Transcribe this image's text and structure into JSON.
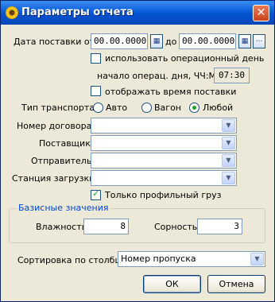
{
  "window": {
    "title": "Параметры отчета",
    "close_glyph": "✕"
  },
  "delivery": {
    "label": "Дата поставки от:",
    "from_value": "00.00.0000",
    "to_label": "до",
    "to_value": "00.00.0000",
    "more_label": "...",
    "use_opday_label": "использовать операционный день",
    "opday_start_label": "начало операц. дня, ЧЧ:ММ:",
    "opday_start_value": "07:30",
    "show_time_label": "отображать время поставки"
  },
  "transport": {
    "label": "Тип транспорта:",
    "options": [
      "Авто",
      "Вагон",
      "Любой"
    ],
    "selected": "Любой"
  },
  "fields": {
    "contract_label": "Номер договора:",
    "supplier_label": "Поставщик:",
    "sender_label": "Отправитель:",
    "station_label": "Станция загрузки:"
  },
  "profile_only": {
    "label": "Только профильный груз",
    "checked": true
  },
  "base_values": {
    "title": "Базисные значения",
    "humidity_label": "Влажность:",
    "humidity_value": "8",
    "impurity_label": "Сорность:",
    "impurity_value": "3"
  },
  "sort": {
    "label": "Сортировка по столбцу:",
    "value": "Номер пропуска"
  },
  "buttons": {
    "ok": "ОК",
    "cancel": "Отмена"
  },
  "icons": {
    "calendar": "calendar-icon",
    "dropdown": "chevron-down-icon",
    "close": "close-icon"
  }
}
